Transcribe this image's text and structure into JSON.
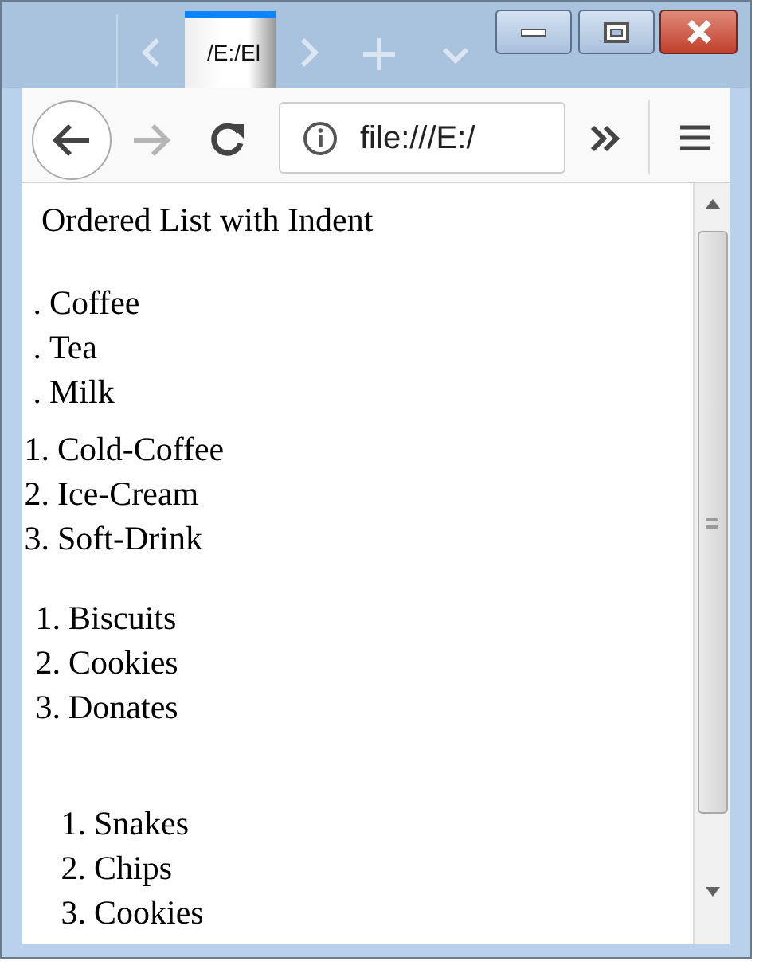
{
  "browser": {
    "tab_title": "/E:/El",
    "address": "file:///E:/"
  },
  "page": {
    "heading": "Ordered List with Indent",
    "lists": [
      {
        "items": [
          {
            "marker": ".",
            "text": "Coffee"
          },
          {
            "marker": ".",
            "text": "Tea"
          },
          {
            "marker": ".",
            "text": "Milk"
          }
        ]
      },
      {
        "items": [
          {
            "marker": "1.",
            "text": "Cold-Coffee"
          },
          {
            "marker": "2.",
            "text": "Ice-Cream"
          },
          {
            "marker": "3.",
            "text": "Soft-Drink"
          }
        ]
      },
      {
        "items": [
          {
            "marker": "1.",
            "text": "Biscuits"
          },
          {
            "marker": "2.",
            "text": "Cookies"
          },
          {
            "marker": "3.",
            "text": "Donates"
          }
        ]
      },
      {
        "items": [
          {
            "marker": "1.",
            "text": "Snakes"
          },
          {
            "marker": "2.",
            "text": "Chips"
          },
          {
            "marker": "3.",
            "text": "Cookies"
          }
        ]
      }
    ]
  }
}
